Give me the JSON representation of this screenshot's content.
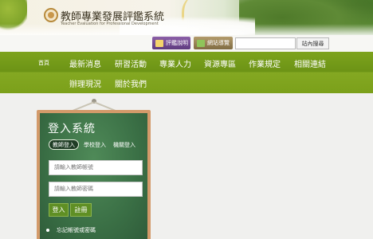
{
  "header": {
    "site_title": "教師專業發展評鑑系統",
    "site_subtitle": "Teacher Evaluation for Professional Development"
  },
  "utility": {
    "btn_a_label": "評鑑說明",
    "btn_b_label": "網站導覽",
    "search_placeholder": "",
    "search_button": "站內搜尋"
  },
  "nav": {
    "home": "首頁",
    "items_row1": [
      "最新消息",
      "研習活動",
      "專業人力",
      "資源專區",
      "作業規定",
      "相關連結"
    ],
    "items_row2": [
      "辦理現況",
      "關於我們"
    ]
  },
  "login": {
    "title": "登入系統",
    "tabs": [
      "教師登入",
      "學校登入",
      "機關登入"
    ],
    "account_placeholder": "請輸入教師帳號",
    "password_placeholder": "請輸入教師密碼",
    "login_button": "登入",
    "register_button": "註冊",
    "forgot_link": "忘記帳號或密碼"
  }
}
